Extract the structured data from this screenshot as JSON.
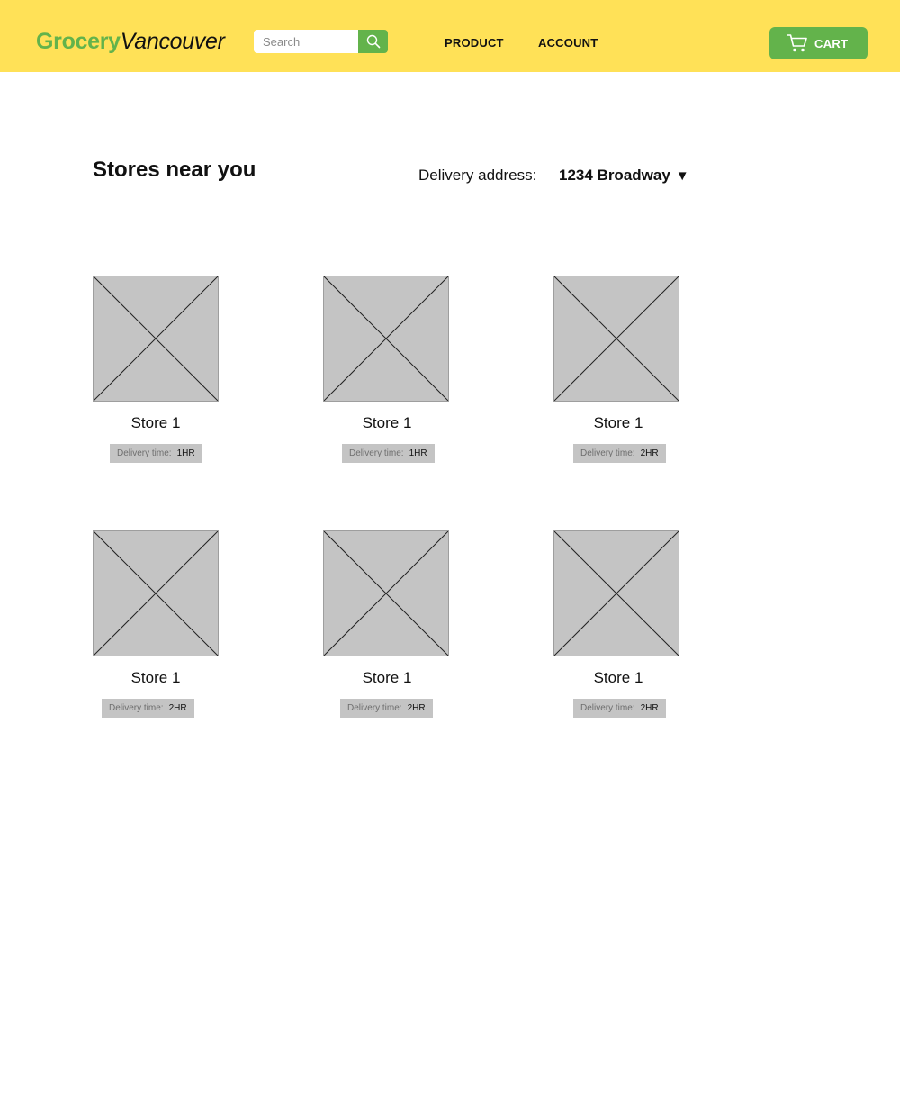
{
  "header": {
    "logo_part1": "Grocery",
    "logo_part2": "Vancouver",
    "search_placeholder": "Search",
    "nav": [
      "PRODUCT",
      "ACCOUNT"
    ],
    "cart_label": "CART"
  },
  "main": {
    "title": "Stores near you",
    "delivery_address_label": "Delivery address:",
    "delivery_address_value": "1234 Broadway"
  },
  "stores": [
    {
      "name": "Store 1",
      "delivery_label": "Delivery time:",
      "delivery_time": "1HR"
    },
    {
      "name": "Store 1",
      "delivery_label": "Delivery time:",
      "delivery_time": "1HR"
    },
    {
      "name": "Store 1",
      "delivery_label": "Delivery time:",
      "delivery_time": "2HR"
    },
    {
      "name": "Store 1",
      "delivery_label": "Delivery time:",
      "delivery_time": "2HR"
    },
    {
      "name": "Store 1",
      "delivery_label": "Delivery time:",
      "delivery_time": "2HR"
    },
    {
      "name": "Store 1",
      "delivery_label": "Delivery time:",
      "delivery_time": "2HR"
    }
  ],
  "icons": {
    "search": "search-icon",
    "cart": "cart-icon",
    "dropdown": "dropdown-arrow-icon",
    "placeholder_image": "image-placeholder-icon"
  },
  "colors": {
    "header_bg": "#ffe157",
    "accent_green": "#63b34b",
    "placeholder_gray": "#c4c4c4"
  }
}
